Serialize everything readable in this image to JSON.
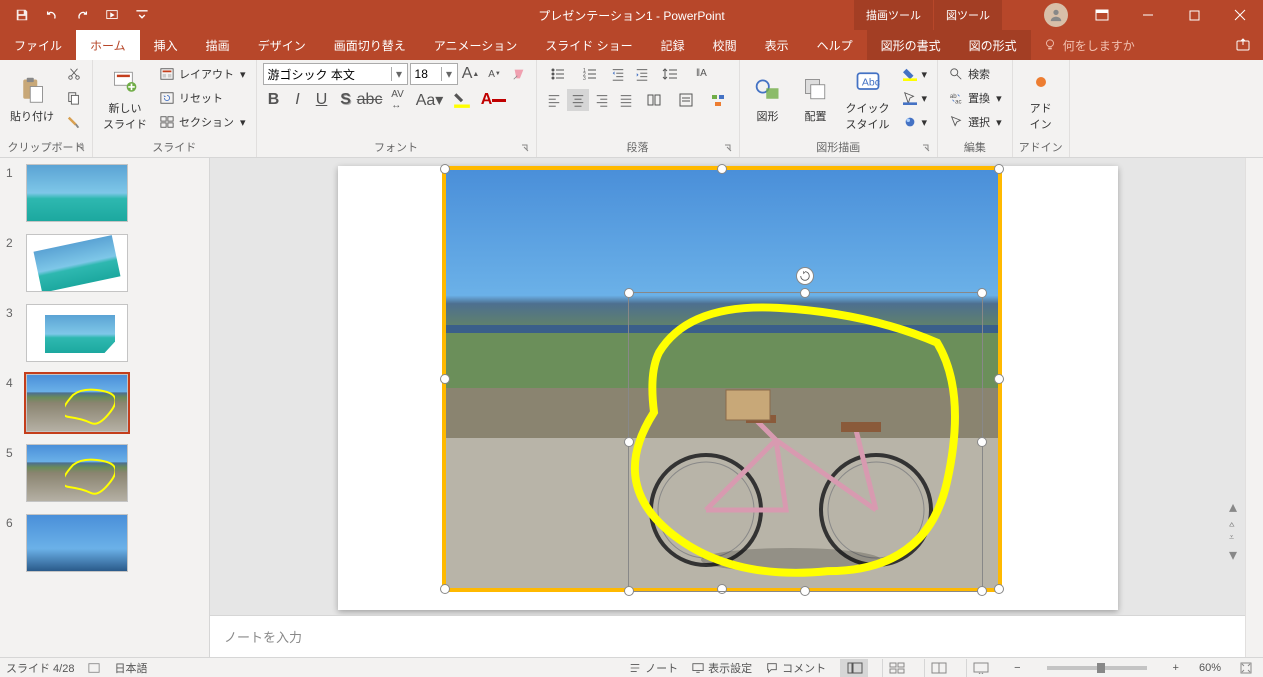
{
  "title_bar": {
    "document_title": "プレゼンテーション1 - PowerPoint",
    "tool_tabs": [
      "描画ツール",
      "図ツール"
    ]
  },
  "tabs": {
    "items": [
      "ファイル",
      "ホーム",
      "挿入",
      "描画",
      "デザイン",
      "画面切り替え",
      "アニメーション",
      "スライド ショー",
      "記録",
      "校閲",
      "表示",
      "ヘルプ",
      "図形の書式",
      "図の形式"
    ],
    "active": "ホーム",
    "tellme": "何をしますか"
  },
  "ribbon": {
    "clipboard": {
      "label": "クリップボード",
      "paste": "貼り付け"
    },
    "slides": {
      "label": "スライド",
      "new_slide": "新しい\nスライド",
      "layout": "レイアウト",
      "reset": "リセット",
      "section": "セクション"
    },
    "font": {
      "label": "フォント",
      "name": "游ゴシック 本文",
      "size": "18"
    },
    "paragraph": {
      "label": "段落"
    },
    "drawing": {
      "label": "図形描画",
      "shapes": "図形",
      "arrange": "配置",
      "quick_styles": "クイック\nスタイル"
    },
    "editing": {
      "label": "編集",
      "find": "検索",
      "replace": "置換",
      "select": "選択"
    },
    "addins": {
      "label": "アドイン",
      "addin": "アド\nイン"
    }
  },
  "thumbnails": {
    "items": [
      {
        "num": "1"
      },
      {
        "num": "2"
      },
      {
        "num": "3"
      },
      {
        "num": "4"
      },
      {
        "num": "5"
      },
      {
        "num": "6"
      }
    ],
    "selected": 4
  },
  "notes": {
    "placeholder": "ノートを入力"
  },
  "status": {
    "slide_counter": "スライド 4/28",
    "language": "日本語",
    "notes_btn": "ノート",
    "display_settings": "表示設定",
    "comments": "コメント",
    "zoom": "60%"
  }
}
